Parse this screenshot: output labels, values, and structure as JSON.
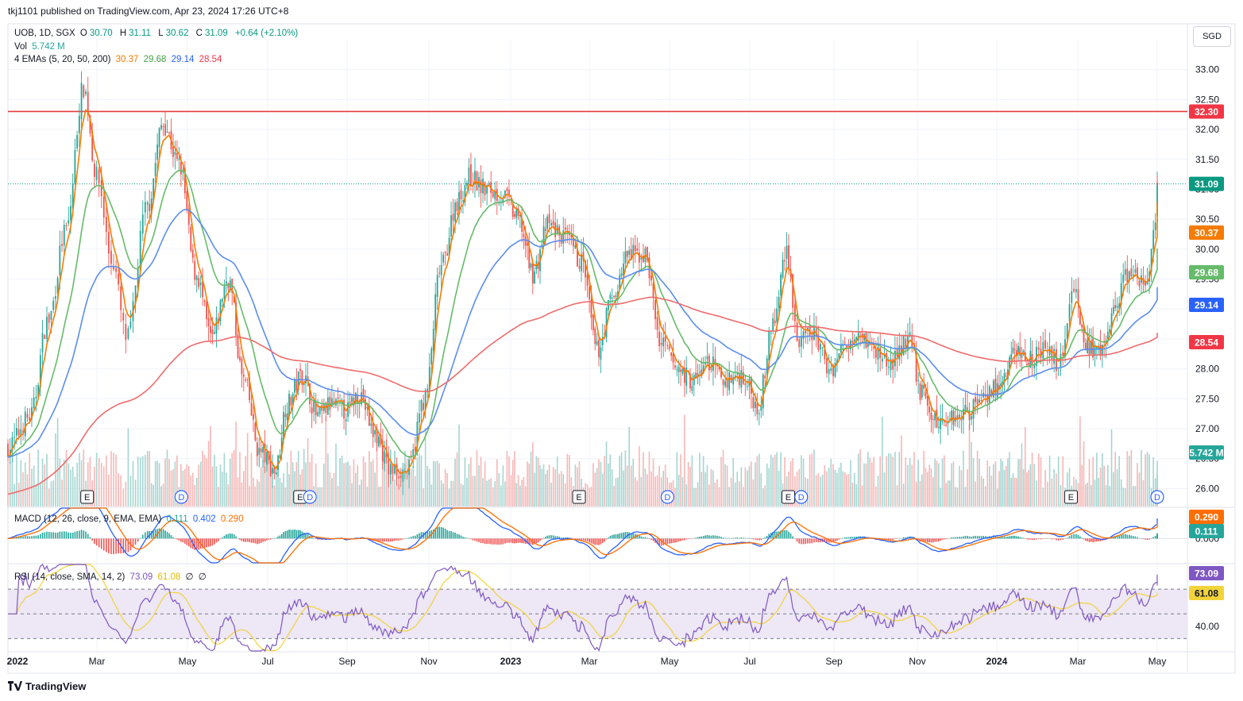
{
  "header": {
    "publish_text": "tkj1101 published on TradingView.com, Apr 23, 2024 17:26 UTC+8"
  },
  "legend": {
    "symbol": "UOB, 1D, SGX",
    "open_label": "O",
    "open": "30.70",
    "high_label": "H",
    "high": "31.11",
    "low_label": "L",
    "low": "30.62",
    "close_label": "C",
    "close": "31.09",
    "change": "+0.64 (+2.10%)",
    "vol_label": "Vol",
    "vol_value": "5.742 M",
    "ema_label": "4 EMAs (5, 20, 50, 200)",
    "ema_values": [
      "30.37",
      "29.68",
      "29.14",
      "28.54"
    ],
    "macd_label": "MACD (12, 26, close, 9, EMA, EMA)",
    "macd_values": [
      "0.111",
      "0.402",
      "0.290"
    ],
    "rsi_label": "RSI (14, close, SMA, 14, 2)",
    "rsi_values": [
      "73.09",
      "61.08",
      "∅",
      "∅"
    ]
  },
  "currency_button": "SGD",
  "footer": {
    "brand": "TradingView"
  },
  "colors": {
    "up": "#26a69a",
    "down": "#ef5350",
    "ema5": "#f57c00",
    "ema20": "#66bb6a",
    "ema50": "#5b8def",
    "ema200": "#ef6b6b",
    "hline": "#e33d3d",
    "macd": "#2962ff",
    "signal": "#ff6d00",
    "rsi": "#7e57c2",
    "rsi_ma": "#f2d33a",
    "rsi_band": "#ede7f6"
  },
  "chart_data": [
    {
      "type": "candlestick",
      "title": "UOB, 1D, SGX",
      "currency": "SGD",
      "x_axis_labels": [
        "2022",
        "Mar",
        "May",
        "Jul",
        "Sep",
        "Nov",
        "2023",
        "Mar",
        "May",
        "Jul",
        "Sep",
        "Nov",
        "2024",
        "Mar",
        "May"
      ],
      "y_axis_ticks": [
        "26.00",
        "26.50",
        "27.00",
        "27.50",
        "28.00",
        "28.50",
        "29.00",
        "29.50",
        "30.00",
        "30.50",
        "31.00",
        "31.50",
        "32.00",
        "32.50",
        "33.00"
      ],
      "ylim": [
        25.7,
        33.5
      ],
      "horizontal_line": 32.3,
      "price_tags": [
        {
          "value": "32.30",
          "color": "#f23645"
        },
        {
          "value": "31.09",
          "color": "#089981"
        },
        {
          "value": "30.37",
          "color": "#f57c00"
        },
        {
          "value": "29.68",
          "color": "#66bb6a"
        },
        {
          "value": "29.14",
          "color": "#2962ff"
        },
        {
          "value": "28.54",
          "color": "#f23645"
        },
        {
          "value": "5.742 M",
          "color": "#26a69a"
        }
      ],
      "series": [
        {
          "name": "Close",
          "x": [
            "Jan 2022",
            "Feb 2022",
            "Mar 2022",
            "Apr 2022",
            "May 2022",
            "Jun 2022",
            "Jul 2022",
            "Aug 2022",
            "Sep 2022",
            "Oct 2022",
            "Nov 2022",
            "Dec 2022",
            "Jan 2023",
            "Feb 2023",
            "Mar 2023",
            "Apr 2023",
            "May 2023",
            "Jun 2023",
            "Jul 2023",
            "Aug 2023",
            "Sep 2023",
            "Oct 2023",
            "Nov 2023",
            "Dec 2023",
            "Jan 2024",
            "Feb 2024",
            "Mar 2024",
            "Apr 2024"
          ],
          "values": [
            27.5,
            32.7,
            29.5,
            31.6,
            28.8,
            26.6,
            27.9,
            27.3,
            27.4,
            26.2,
            29.9,
            31.1,
            30.6,
            30.4,
            28.3,
            29.8,
            28.1,
            27.8,
            27.9,
            28.4,
            28.3,
            27.9,
            27.4,
            27.6,
            28.3,
            28.3,
            28.6,
            31.09
          ]
        },
        {
          "name": "EMA 200",
          "x": [
            "Jan 2022",
            "Apr 2022",
            "Jul 2022",
            "Oct 2022",
            "Jan 2023",
            "Apr 2023",
            "Jul 2023",
            "Oct 2023",
            "Jan 2024",
            "Apr 2024"
          ],
          "values": [
            26.0,
            28.1,
            28.3,
            27.7,
            28.6,
            29.2,
            28.8,
            28.5,
            28.2,
            28.54
          ]
        }
      ],
      "events": [
        {
          "date": "Feb 2022",
          "label": "E"
        },
        {
          "date": "Apr 2022",
          "label": "D"
        },
        {
          "date": "Jul 2022",
          "label": "E"
        },
        {
          "date": "Jul 2022",
          "label": "D"
        },
        {
          "date": "Feb 2023",
          "label": "E"
        },
        {
          "date": "Apr 2023",
          "label": "D"
        },
        {
          "date": "Jul 2023",
          "label": "E"
        },
        {
          "date": "Aug 2023",
          "label": "D"
        },
        {
          "date": "Feb 2024",
          "label": "E"
        },
        {
          "date": "Apr 2024",
          "label": "D"
        }
      ]
    },
    {
      "type": "line",
      "title": "MACD (12, 26, close, 9, EMA, EMA)",
      "y_axis_ticks": [
        "0.000"
      ],
      "ylim": [
        -0.6,
        0.75
      ],
      "latest": {
        "histogram": 0.111,
        "macd": 0.402,
        "signal": 0.29
      },
      "price_tags": [
        {
          "value": "0.290",
          "color": "#ff6d00"
        },
        {
          "value": "0.111",
          "color": "#26a69a"
        }
      ]
    },
    {
      "type": "line",
      "title": "RSI (14, close, SMA, 14, 2)",
      "y_axis_ticks": [
        "40.00"
      ],
      "ylim": [
        20,
        90
      ],
      "band": [
        30,
        70
      ],
      "latest": {
        "rsi": 73.09,
        "rsi_ma": 61.08
      },
      "price_tags": [
        {
          "value": "73.09",
          "color": "#7e57c2"
        },
        {
          "value": "61.08",
          "color": "#f2d33a"
        }
      ]
    }
  ]
}
